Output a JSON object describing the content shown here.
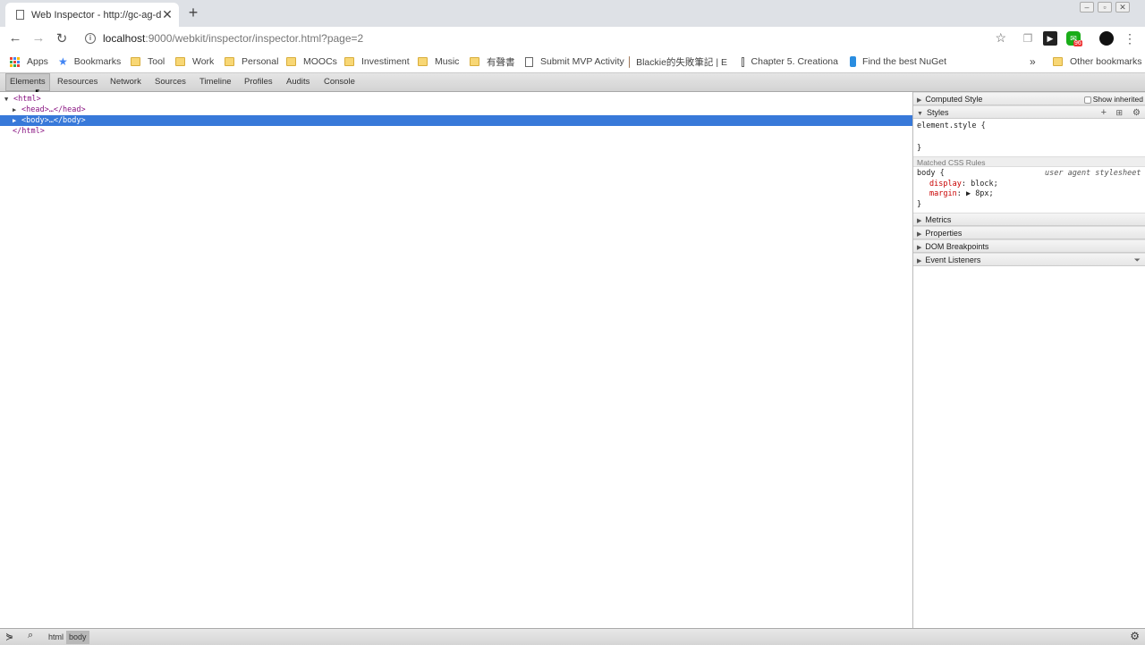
{
  "browser": {
    "tab_title": "Web Inspector - http://gc-ag-dc",
    "tab_close": "✕",
    "newtab": "+",
    "url_host": "localhost",
    "url_path": ":9000/webkit/inspector/inspector.html?page=2",
    "back": "←",
    "forward": "→",
    "reload": "↻",
    "star": "☆",
    "ext_badge": "96"
  },
  "bookmarks": [
    {
      "label": "Apps",
      "icon": "apps-grid-icon"
    },
    {
      "label": "Bookmarks",
      "icon": "star-icon"
    },
    {
      "label": "Tool",
      "icon": "folder-icon"
    },
    {
      "label": "Work",
      "icon": "folder-icon"
    },
    {
      "label": "Personal",
      "icon": "folder-icon"
    },
    {
      "label": "MOOCs",
      "icon": "folder-icon"
    },
    {
      "label": "Investiment",
      "icon": "folder-icon"
    },
    {
      "label": "Music",
      "icon": "folder-icon"
    },
    {
      "label": "有聲書",
      "icon": "folder-icon"
    },
    {
      "label": "Submit MVP Activity",
      "icon": "page-icon"
    },
    {
      "label": "Blackie的失敗筆記 | E",
      "icon": "avatar-icon"
    },
    {
      "label": "Chapter 5. Creationa",
      "icon": "page-icon"
    },
    {
      "label": "Find the best NuGet",
      "icon": "nuget-icon"
    },
    {
      "label": "»",
      "icon": ""
    },
    {
      "label": "Other bookmarks",
      "icon": "folder-icon"
    }
  ],
  "inspector": {
    "tabs": [
      "Elements",
      "Resources",
      "Network",
      "Sources",
      "Timeline",
      "Profiles",
      "Audits",
      "Console"
    ],
    "active_tab": "Elements",
    "dom": [
      {
        "tri": "▼",
        "text": "<html>"
      },
      {
        "tri": "▶",
        "text": "<head>…</head>"
      },
      {
        "tri": "▶",
        "text": "<body>…</body>"
      },
      {
        "tri": "",
        "text": "</html>"
      }
    ],
    "sidebar": {
      "computed_style": "Computed Style",
      "show_inherited": "Show inherited",
      "styles": "Styles",
      "element_style_open": "element.style {",
      "element_style_close": "}",
      "matched_rules": "Matched CSS Rules",
      "rule_selector": "body {",
      "rule_source": "user agent stylesheet",
      "decl1_prop": "display",
      "decl1_val": ": block;",
      "decl2_prop": "margin",
      "decl2_val": ": ▶ 8px;",
      "rule_close": "}",
      "metrics": "Metrics",
      "properties": "Properties",
      "dom_breakpoints": "DOM Breakpoints",
      "event_listeners": "Event Listeners"
    },
    "breadcrumbs": [
      "html",
      "body"
    ]
  },
  "colors": {
    "selection": "#3879d9",
    "tag": "#881280",
    "css_prop": "#c80000"
  }
}
